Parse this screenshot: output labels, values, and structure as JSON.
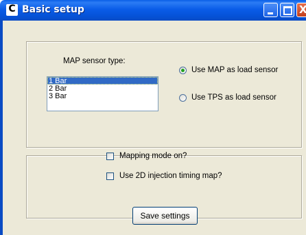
{
  "window": {
    "title": "Basic setup",
    "app_icon_letter": "C"
  },
  "titlebar_buttons": {
    "close_glyph": "X"
  },
  "sensor_group": {
    "map_sensor_label": "MAP sensor type:",
    "map_sensor_options": [
      "1 Bar",
      "2 Bar",
      "3 Bar"
    ],
    "selected_option": "1 Bar",
    "load_sensor": {
      "use_map_label": "Use MAP as load sensor",
      "use_tps_label": "Use TPS as load sensor",
      "selected": "Use MAP as load sensor"
    }
  },
  "mode_group": {
    "mapping_mode_label": "Mapping mode on?",
    "mapping_mode_checked": false,
    "use_2d_label": "Use 2D injection timing map?",
    "use_2d_checked": false
  },
  "save_button_label": "Save settings",
  "colors": {
    "titlebar": "#0a5ce8",
    "selection": "#316ac5",
    "dialog_bg": "#ece9d8"
  }
}
